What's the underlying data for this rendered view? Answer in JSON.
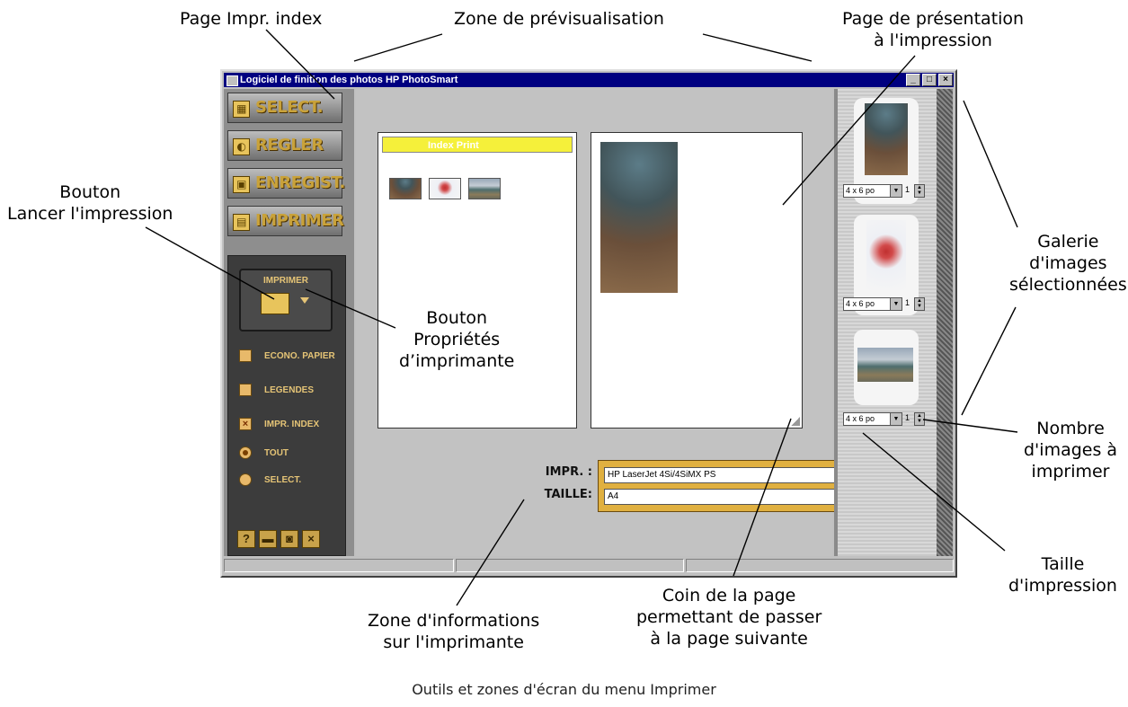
{
  "window": {
    "title": "Logiciel de finition des photos HP PhotoSmart",
    "controls": [
      "_",
      "□",
      "×"
    ]
  },
  "nav": [
    {
      "label": "SELECT.",
      "icon": "select-icon"
    },
    {
      "label": "REGLER",
      "icon": "adjust-icon"
    },
    {
      "label": "ENREGIST.",
      "icon": "save-icon"
    },
    {
      "label": "IMPRIMER",
      "icon": "print-icon"
    }
  ],
  "print_panel": {
    "print_button_label": "IMPRIMER",
    "options": [
      {
        "label": "ECONO. PAPIER",
        "checked": false
      },
      {
        "label": "LEGENDES",
        "checked": false
      },
      {
        "label": "IMPR. INDEX",
        "checked": true
      }
    ],
    "radios": [
      {
        "label": "TOUT",
        "selected": true
      },
      {
        "label": "SELECT.",
        "selected": false
      }
    ],
    "bottom_icons": [
      "help-icon",
      "folder-icon",
      "camera-icon",
      "close-icon"
    ]
  },
  "preview": {
    "index_page_header": "Index Print"
  },
  "printer_info": {
    "printer_label": "IMPR. :",
    "printer_value": "HP LaserJet 4Si/4SiMX PS",
    "size_label": "TAILLE:",
    "size_value": "A4"
  },
  "gallery": {
    "items": [
      {
        "size": "4 x 6 po",
        "count": "1"
      },
      {
        "size": "4 x 6 po",
        "count": "1"
      },
      {
        "size": "4 x 6 po",
        "count": "1"
      }
    ]
  },
  "callouts": {
    "page_index": "Page Impr. index",
    "preview_zone": "Zone de prévisualisation",
    "presentation_page": [
      "Page de présentation",
      "à l'impression"
    ],
    "launch_print": [
      "Bouton",
      "Lancer l'impression"
    ],
    "printer_props": [
      "Bouton",
      "Propriétés",
      "d’imprimante"
    ],
    "gallery": [
      "Galerie",
      "d'images",
      "sélectionnées"
    ],
    "count": [
      "Nombre",
      "d'images à",
      "imprimer"
    ],
    "print_size": [
      "Taille",
      "d'impression"
    ],
    "page_corner": [
      "Coin de la page",
      "permettant de passer",
      "à la page suivante"
    ],
    "printer_zone": [
      "Zone d'informations",
      "sur l'imprimante"
    ]
  },
  "caption": "Outils et zones d'écran du menu Imprimer",
  "colors": {
    "titlebar": "#000080",
    "accent_gold": "#e0b040",
    "index_header": "#f5f03a"
  }
}
